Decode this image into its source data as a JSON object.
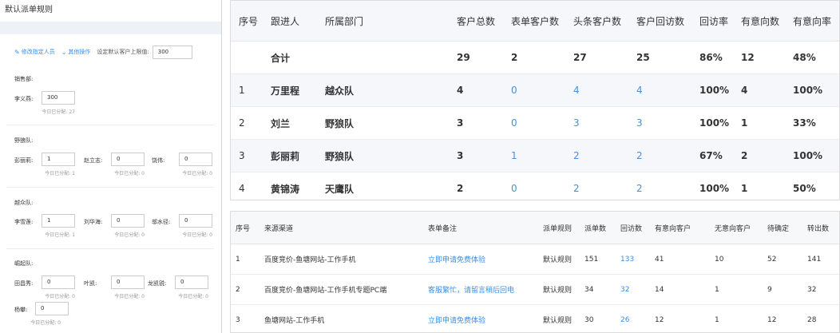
{
  "left_panel": {
    "title": "默认派单规则",
    "toolbar": {
      "edit_label": "修改指定人员",
      "more_label": "其他操作",
      "limit_label": "设定默认客户上限值:",
      "limit_value": "300"
    },
    "allocated_prefix": "今日已分配:",
    "groups": [
      {
        "name": "销售部:",
        "members": [
          {
            "name": "李义燕:",
            "value": "300",
            "allocated": "今日已分配: 27"
          }
        ]
      },
      {
        "name": "野狼队:",
        "members": [
          {
            "name": "彭丽莉:",
            "value": "1",
            "allocated": "今日已分配: 1"
          },
          {
            "name": "赵立志:",
            "value": "0",
            "allocated": "今日已分配: 0"
          },
          {
            "name": "饶伟:",
            "value": "0",
            "allocated": "今日已分配: 0"
          }
        ]
      },
      {
        "name": "越众队:",
        "members": [
          {
            "name": "李雪莲:",
            "value": "1",
            "allocated": "今日已分配: 1"
          },
          {
            "name": "刘华海:",
            "value": "0",
            "allocated": "今日已分配: 0"
          },
          {
            "name": "邬水径:",
            "value": "0",
            "allocated": "今日已分配: 0"
          }
        ]
      },
      {
        "name": "崛起队:",
        "members": [
          {
            "name": "田昌秀:",
            "value": "0",
            "allocated": "今日已分配: 0"
          },
          {
            "name": "叶凯:",
            "value": "0",
            "allocated": "今日已分配: 0"
          },
          {
            "name": "龙凯锐:",
            "value": "0",
            "allocated": "今日已分配: 0"
          },
          {
            "name": "杨攀:",
            "value": "0",
            "allocated": "今日已分配: 0"
          }
        ]
      }
    ]
  },
  "followup_table": {
    "headers": [
      "序号",
      "跟进人",
      "所属部门",
      "客户总数",
      "表单客户数",
      "头条客户数",
      "客户回访数",
      "回访率",
      "有意向数",
      "有意向率"
    ],
    "total_row": [
      "",
      "合计",
      "",
      "29",
      "2",
      "27",
      "25",
      "86%",
      "12",
      "48%"
    ],
    "rows": [
      [
        "1",
        "万里程",
        "越众队",
        "4",
        "0",
        "4",
        "4",
        "100%",
        "4",
        "100%"
      ],
      [
        "2",
        "刘兰",
        "野狼队",
        "3",
        "0",
        "3",
        "3",
        "100%",
        "1",
        "33%"
      ],
      [
        "3",
        "彭丽莉",
        "野狼队",
        "3",
        "1",
        "2",
        "2",
        "67%",
        "2",
        "100%"
      ],
      [
        "4",
        "黄锦涛",
        "天鹰队",
        "2",
        "0",
        "2",
        "2",
        "100%",
        "1",
        "50%"
      ]
    ]
  },
  "source_table": {
    "headers": [
      "序号",
      "来源渠道",
      "表单备注",
      "派单规则",
      "派单数",
      "回访数",
      "有意向客户",
      "无意向客户",
      "待确定",
      "转出数"
    ],
    "rows": [
      [
        "1",
        "百度竞价-鱼塘网站-工作手机",
        "立即申请免费体验",
        "默认规则",
        "151",
        "133",
        "41",
        "10",
        "52",
        "141"
      ],
      [
        "2",
        "百度竞价-鱼塘网站-工作手机专题PC端",
        "客服繁忙，请留言稍后回电",
        "默认规则",
        "34",
        "32",
        "14",
        "1",
        "9",
        "32"
      ],
      [
        "3",
        "鱼塘网站-工作手机",
        "立即申请免费体验",
        "默认规则",
        "30",
        "26",
        "12",
        "1",
        "12",
        "28"
      ]
    ]
  },
  "colors": {
    "link": "#3a8ee6",
    "header_bg": "#f6f7fb",
    "gap_bg": "#eef1f5"
  }
}
